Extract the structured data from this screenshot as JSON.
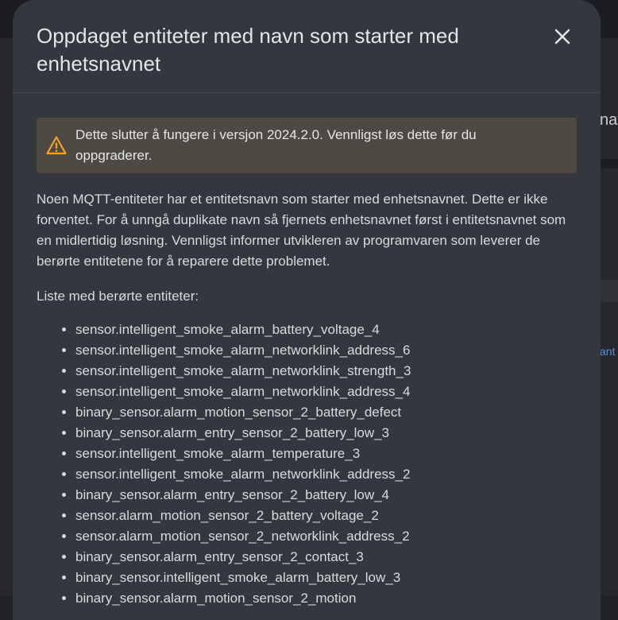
{
  "background": {
    "partial_text_1": "nav",
    "partial_text_2": "ant"
  },
  "dialog": {
    "title": "Oppdaget entiteter med navn som starter med enhetsnavnet",
    "close_icon": "close-icon",
    "warning": {
      "icon": "warning-icon",
      "text": "Dette slutter å fungere i versjon 2024.2.0. Vennligst løs dette før du oppgraderer.",
      "color": "#f0a22a"
    },
    "description": "Noen MQTT-entiteter har et entitetsnavn som starter med enhetsnavnet. Dette er ikke forventet. For å unngå duplikate navn så fjernets enhetsnavnet først i entitetsnavnet som en midlertidig løsning. Vennligst informer utvikleren av programvaren som leverer de berørte entitetene for å reparere dette problemet.",
    "list_heading": "Liste med berørte entiteter:",
    "entities": [
      "sensor.intelligent_smoke_alarm_battery_voltage_4",
      "sensor.intelligent_smoke_alarm_networklink_address_6",
      "sensor.intelligent_smoke_alarm_networklink_strength_3",
      "sensor.intelligent_smoke_alarm_networklink_address_4",
      "binary_sensor.alarm_motion_sensor_2_battery_defect",
      "binary_sensor.alarm_entry_sensor_2_battery_low_3",
      "sensor.intelligent_smoke_alarm_temperature_3",
      "sensor.intelligent_smoke_alarm_networklink_address_2",
      "binary_sensor.alarm_entry_sensor_2_battery_low_4",
      "sensor.alarm_motion_sensor_2_battery_voltage_2",
      "sensor.alarm_motion_sensor_2_networklink_address_2",
      "binary_sensor.alarm_entry_sensor_2_contact_3",
      "binary_sensor.intelligent_smoke_alarm_battery_low_3",
      "binary_sensor.alarm_motion_sensor_2_motion"
    ]
  }
}
